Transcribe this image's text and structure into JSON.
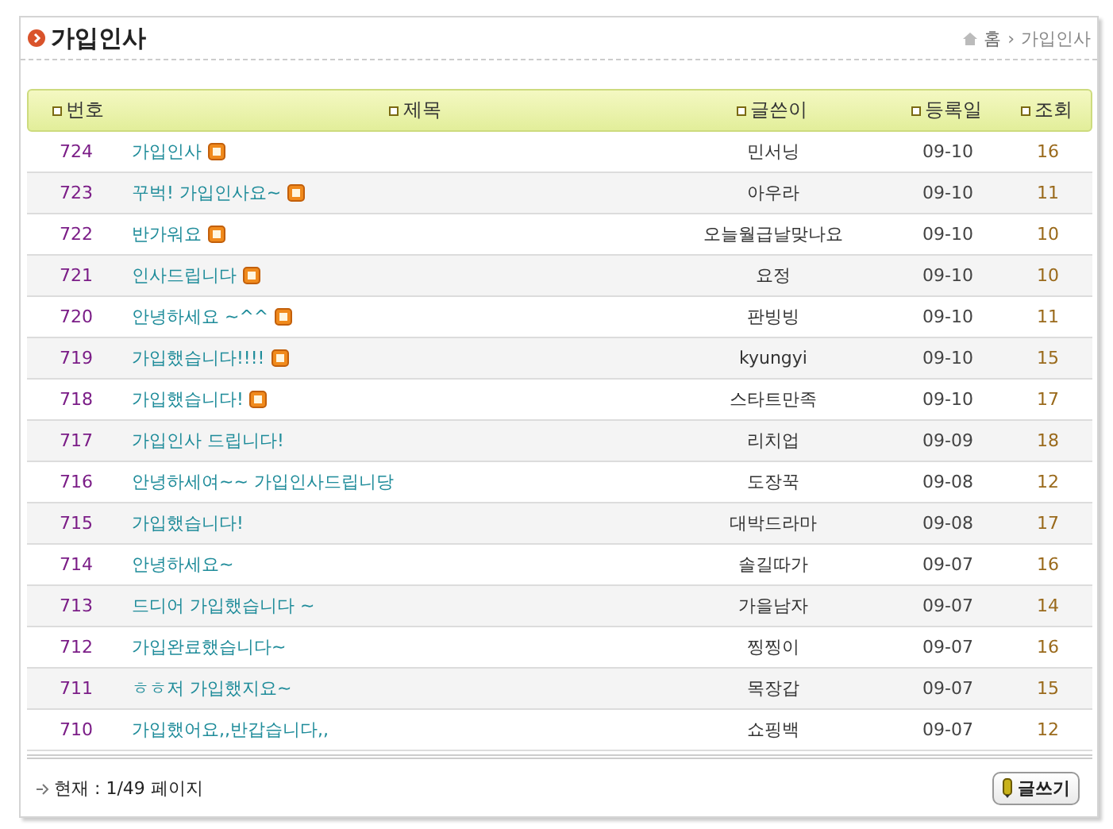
{
  "header": {
    "title": "가입인사",
    "breadcrumb": [
      "홈",
      "›",
      "가입인사"
    ]
  },
  "table": {
    "columns": [
      "번호",
      "제목",
      "글쓴이",
      "등록일",
      "조회"
    ],
    "rows": [
      {
        "number": "724",
        "title": "가입인사",
        "new": true,
        "author": "민서닝",
        "date": "09-10",
        "views": "16"
      },
      {
        "number": "723",
        "title": "꾸벅! 가입인사요~",
        "new": true,
        "author": "아우라",
        "date": "09-10",
        "views": "11"
      },
      {
        "number": "722",
        "title": "반가워요",
        "new": true,
        "author": "오늘월급날맞나요",
        "date": "09-10",
        "views": "10"
      },
      {
        "number": "721",
        "title": "인사드립니다",
        "new": true,
        "author": "요정",
        "date": "09-10",
        "views": "10"
      },
      {
        "number": "720",
        "title": "안녕하세요 ~^^",
        "new": true,
        "author": "판빙빙",
        "date": "09-10",
        "views": "11"
      },
      {
        "number": "719",
        "title": "가입했습니다!!!!",
        "new": true,
        "author": "kyungyi",
        "date": "09-10",
        "views": "15"
      },
      {
        "number": "718",
        "title": "가입했습니다!",
        "new": true,
        "author": "스타트만족",
        "date": "09-10",
        "views": "17"
      },
      {
        "number": "717",
        "title": "가입인사 드립니다!",
        "new": false,
        "author": "리치업",
        "date": "09-09",
        "views": "18"
      },
      {
        "number": "716",
        "title": "안녕하세여~~ 가입인사드립니당",
        "new": false,
        "author": "도장꾹",
        "date": "09-08",
        "views": "12"
      },
      {
        "number": "715",
        "title": "가입했습니다!",
        "new": false,
        "author": "대박드라마",
        "date": "09-08",
        "views": "17"
      },
      {
        "number": "714",
        "title": "안녕하세요~",
        "new": false,
        "author": "솔길따가",
        "date": "09-07",
        "views": "16"
      },
      {
        "number": "713",
        "title": "드디어 가입했습니다 ~",
        "new": false,
        "author": "가을남자",
        "date": "09-07",
        "views": "14"
      },
      {
        "number": "712",
        "title": "가입완료했습니다~",
        "new": false,
        "author": "찡찡이",
        "date": "09-07",
        "views": "16"
      },
      {
        "number": "711",
        "title": "ㅎㅎ저 가입했지요~",
        "new": false,
        "author": "목장갑",
        "date": "09-07",
        "views": "15"
      },
      {
        "number": "710",
        "title": "가입했어요,,반갑습니다,,",
        "new": false,
        "author": "쇼핑백",
        "date": "09-07",
        "views": "12"
      }
    ]
  },
  "footer": {
    "page_info": "현재 : 1/49 페이지",
    "write_button": "글쓰기"
  }
}
